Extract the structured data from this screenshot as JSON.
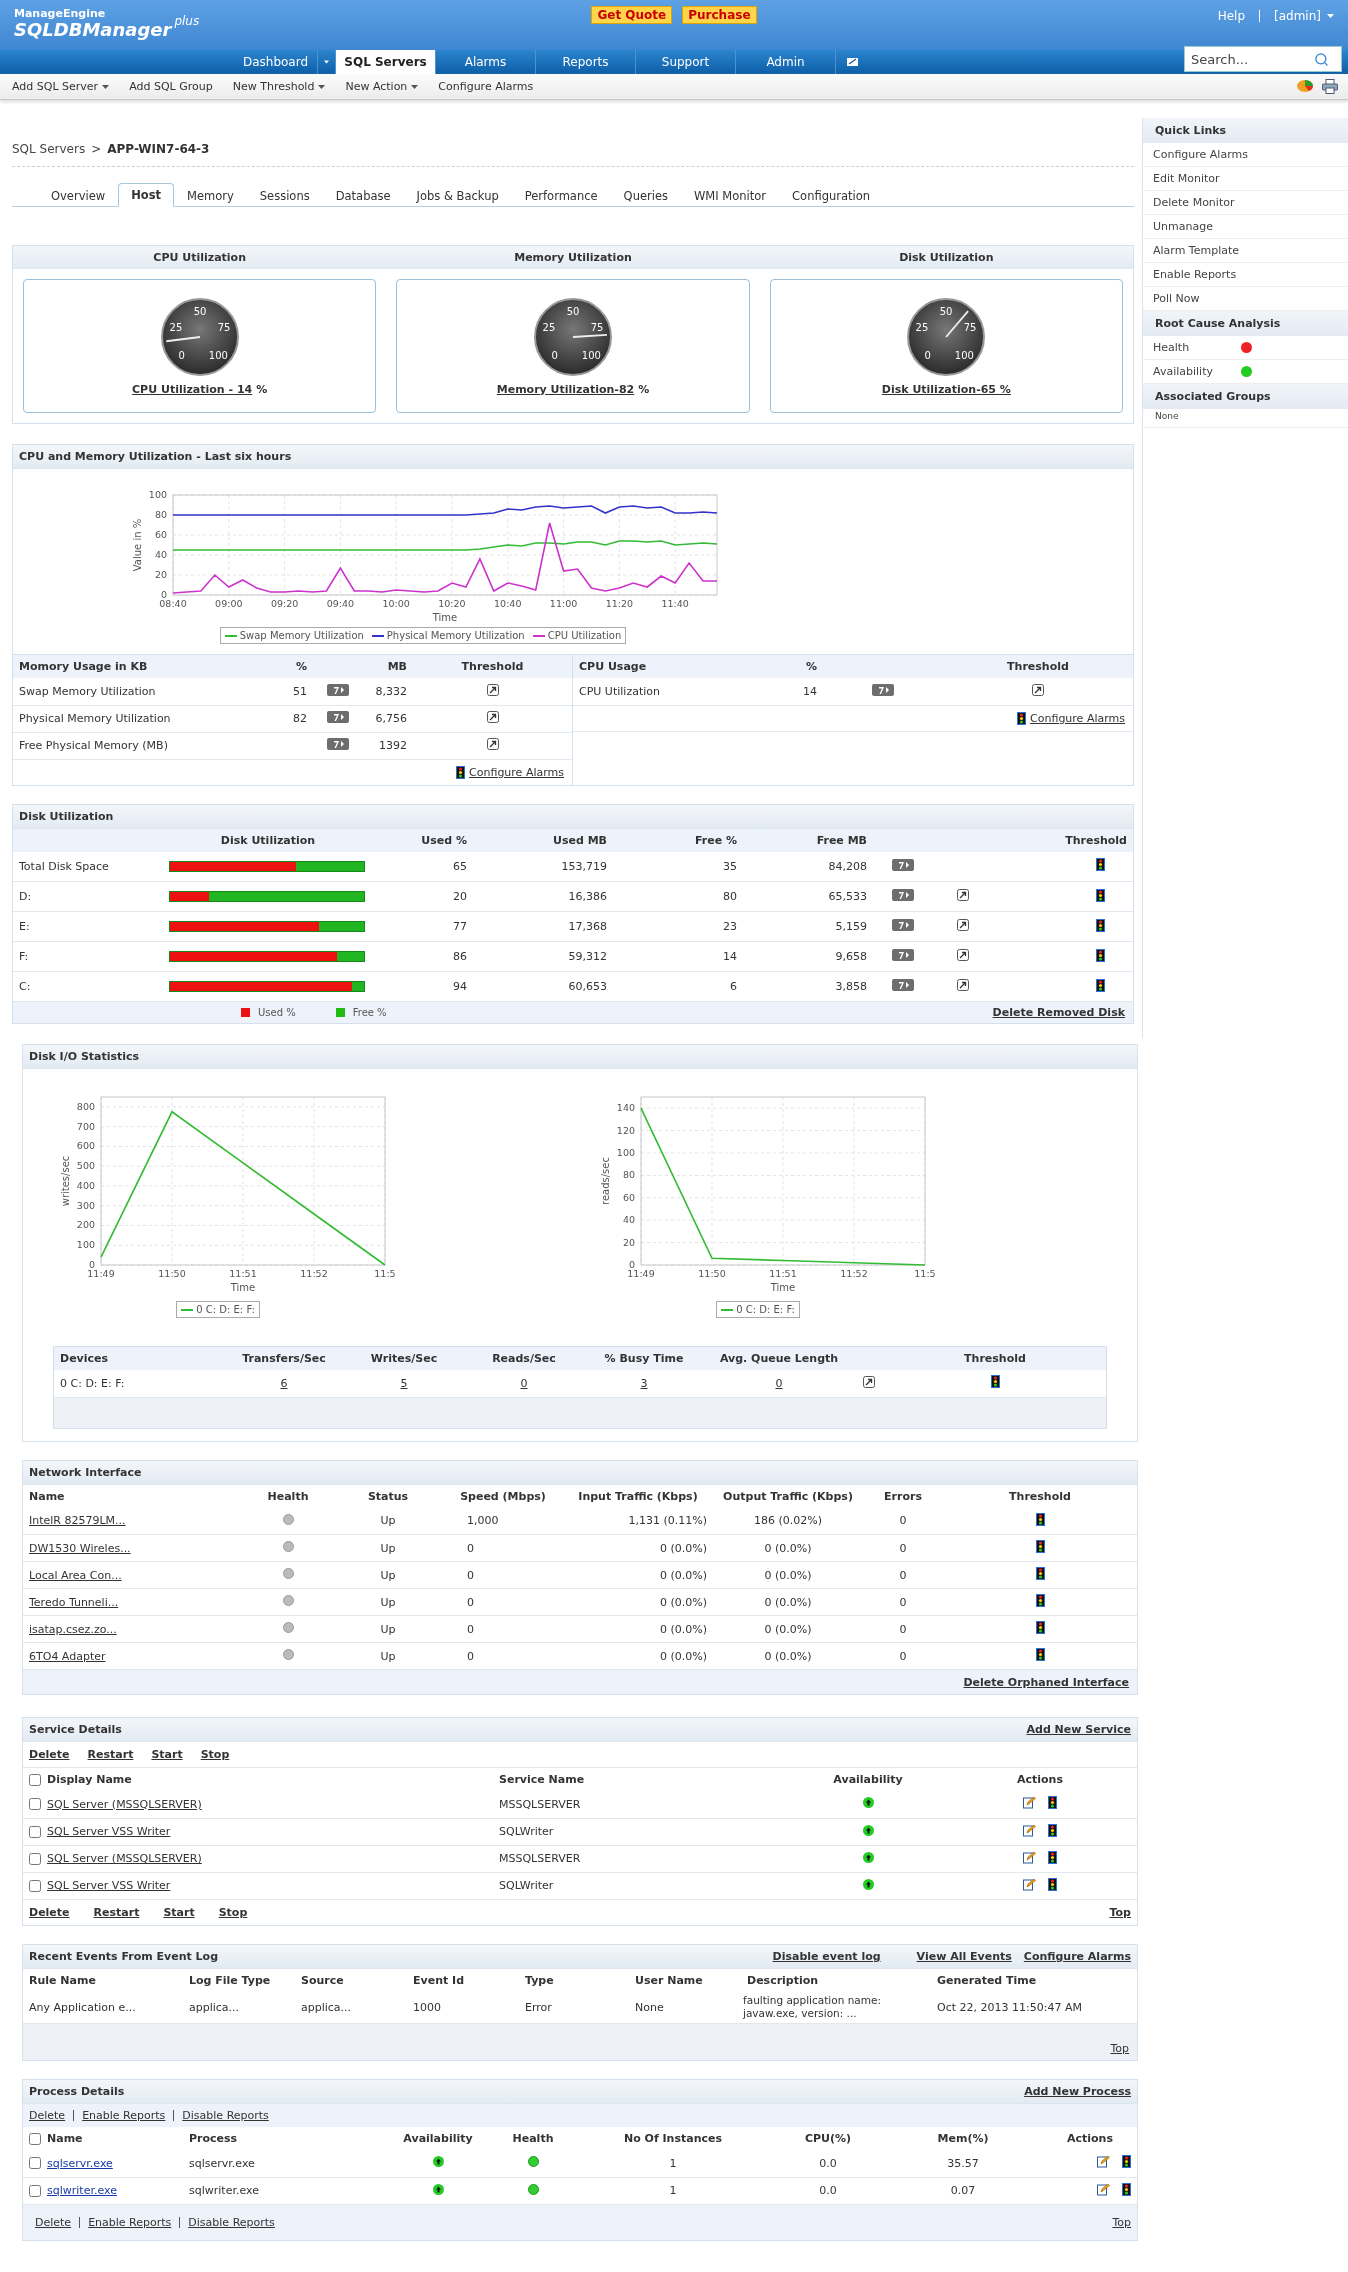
{
  "header": {
    "logo_top": "ManageEngine",
    "logo_main": "SQLDBManager",
    "logo_sup": "plus",
    "buttons": [
      "Get Quote",
      "Purchase"
    ],
    "help": "Help",
    "user": "[admin]"
  },
  "nav": {
    "items": [
      {
        "label": "Dashboard",
        "selected": false,
        "split": true
      },
      {
        "label": "SQL Servers",
        "selected": true,
        "split": false
      },
      {
        "label": "Alarms",
        "selected": false,
        "split": false
      },
      {
        "label": "Reports",
        "selected": false,
        "split": false
      },
      {
        "label": "Support",
        "selected": false,
        "split": false
      },
      {
        "label": "Admin",
        "selected": false,
        "split": false
      }
    ],
    "search": {
      "placeholder": "Search..."
    }
  },
  "toolbar": {
    "items": [
      {
        "label": "Add SQL Server",
        "dropdown": true
      },
      {
        "label": "Add SQL Group",
        "dropdown": false
      },
      {
        "label": "New Threshold",
        "dropdown": true
      },
      {
        "label": "New Action",
        "dropdown": true
      },
      {
        "label": "Configure Alarms",
        "dropdown": false
      }
    ]
  },
  "breadcrumb": {
    "parent": "SQL Servers",
    "separator": ">",
    "current": "APP-WIN7-64-3"
  },
  "tabs": [
    {
      "label": "Overview",
      "selected": false
    },
    {
      "label": "Host",
      "selected": true
    },
    {
      "label": "Memory",
      "selected": false
    },
    {
      "label": "Sessions",
      "selected": false
    },
    {
      "label": "Database",
      "selected": false
    },
    {
      "label": "Jobs & Backup",
      "selected": false
    },
    {
      "label": "Performance",
      "selected": false
    },
    {
      "label": "Queries",
      "selected": false
    },
    {
      "label": "WMI Monitor",
      "selected": false
    },
    {
      "label": "Configuration",
      "selected": false
    }
  ],
  "gauges": [
    {
      "title": "CPU Utilization",
      "level": 0.14,
      "scale": [
        "0",
        "25",
        "50",
        "75",
        "100"
      ],
      "link": "CPU Utilization - 14",
      "unit": "%"
    },
    {
      "title": "Memory Utilization",
      "level": 0.82,
      "scale": [
        "0",
        "25",
        "50",
        "75",
        "100"
      ],
      "link": "Memory Utilization-82",
      "unit": "%"
    },
    {
      "title": "Disk Utilization",
      "level": 0.65,
      "scale": [
        "0",
        "25",
        "50",
        "75",
        "100"
      ],
      "link": "Disk Utilization-65 %"
    }
  ],
  "cpu_memory": {
    "title": "CPU and Memory Utilization - Last six hours",
    "chart_data": {
      "type": "line",
      "xlabel": "Time",
      "ylabel": "Value in %",
      "ylim": [
        0,
        100
      ],
      "yticks": [
        0,
        20,
        40,
        60,
        80,
        100
      ],
      "grid": true,
      "legend": "bottom",
      "categories": [
        "08:40",
        null,
        null,
        null,
        "09:00",
        null,
        null,
        null,
        "09:20",
        null,
        null,
        null,
        "09:40",
        null,
        null,
        null,
        "10:00",
        null,
        null,
        null,
        "10:20",
        null,
        null,
        null,
        "10:40",
        null,
        null,
        null,
        "11:00",
        null,
        null,
        null,
        "11:20",
        null,
        null,
        null,
        "11:40",
        null,
        null,
        null
      ],
      "series": [
        {
          "name": "Swap Memory Utilization",
          "color": "#33bb33",
          "values": [
            45,
            45,
            45,
            45,
            45,
            45,
            45,
            45,
            45,
            45,
            45,
            45,
            45,
            45,
            45,
            45,
            45,
            45,
            45,
            45,
            45,
            45,
            46,
            48,
            50,
            49,
            52,
            52,
            51,
            53,
            53,
            50,
            54,
            54,
            53,
            54,
            50,
            51,
            52,
            51
          ]
        },
        {
          "name": "Physical Memory Utilization",
          "color": "#3333cc",
          "values": [
            80,
            80,
            80,
            80,
            80,
            80,
            80,
            80,
            80,
            80,
            80,
            80,
            80,
            80,
            80,
            80,
            80,
            80,
            80,
            80,
            80,
            80,
            81,
            82,
            86,
            85,
            88,
            89,
            87,
            88,
            89,
            82,
            88,
            89,
            87,
            88,
            82,
            82,
            83,
            82
          ]
        },
        {
          "name": "CPU Utilization",
          "color": "#cc33cc",
          "values": [
            2,
            3,
            4,
            20,
            8,
            15,
            7,
            3,
            3,
            4,
            3,
            4,
            27,
            4,
            4,
            3,
            5,
            4,
            3,
            4,
            12,
            8,
            36,
            4,
            12,
            9,
            5,
            72,
            24,
            26,
            7,
            4,
            7,
            12,
            8,
            19,
            12,
            32,
            14,
            14
          ]
        }
      ]
    },
    "memory_table": {
      "columns": [
        "Momory Usage in KB",
        "%",
        "MB",
        "Threshold"
      ],
      "rows": [
        {
          "name": "Swap Memory Utilization",
          "percent": "51",
          "mb": "8,332"
        },
        {
          "name": "Physical Memory Utilization",
          "percent": "82",
          "mb": "6,756"
        },
        {
          "name": "Free Physical Memory (MB)",
          "mb": "1392"
        }
      ],
      "configure": "Configure Alarms"
    },
    "cpu_table": {
      "columns": [
        "CPU Usage",
        "%",
        "Threshold"
      ],
      "rows": [
        {
          "name": "CPU Utilization",
          "percent": "14"
        }
      ],
      "configure": "Configure Alarms"
    }
  },
  "disk": {
    "title": "Disk Utilization",
    "columns": [
      "Disk Utilization",
      "Used %",
      "Used MB",
      "Free %",
      "Free MB",
      "Threshold"
    ],
    "rows": [
      {
        "name": "Total Disk Space",
        "level": 0.65,
        "used_pct": "65",
        "used_mb": "153,719",
        "free_pct": "35",
        "free_mb": "84,208",
        "edit": false
      },
      {
        "name": "D:",
        "level": 0.2,
        "used_pct": "20",
        "used_mb": "16,386",
        "free_pct": "80",
        "free_mb": "65,533",
        "edit": true
      },
      {
        "name": "E:",
        "level": 0.77,
        "used_pct": "77",
        "used_mb": "17,368",
        "free_pct": "23",
        "free_mb": "5,159",
        "edit": true
      },
      {
        "name": "F:",
        "level": 0.86,
        "used_pct": "86",
        "used_mb": "59,312",
        "free_pct": "14",
        "free_mb": "9,658",
        "edit": true
      },
      {
        "name": "C:",
        "level": 0.94,
        "used_pct": "94",
        "used_mb": "60,653",
        "free_pct": "6",
        "free_mb": "3,858",
        "edit": true
      }
    ],
    "legend": [
      {
        "label": "Used %",
        "color": "#ee1111"
      },
      {
        "label": "Free %",
        "color": "#22bb11"
      }
    ],
    "link": "Delete Removed Disk"
  },
  "disk_io": {
    "title": "Disk I/O Statistics",
    "charts": [
      {
        "chart_data": {
          "type": "line",
          "xlabel": "Time",
          "ylabel": "writes/sec",
          "ylim": [
            0,
            850
          ],
          "yticks": [
            0,
            100,
            200,
            300,
            400,
            500,
            600,
            700,
            800
          ],
          "grid": true,
          "legend": "bottom",
          "categories": [
            "11:49",
            "11:50",
            "11:51",
            "11:52",
            "11:5"
          ],
          "series": [
            {
              "name": "0 C: D: E: F:",
              "color": "#33bb33",
              "values": [
                40,
                775,
                517,
                258,
                0
              ]
            }
          ]
        }
      },
      {
        "chart_data": {
          "type": "line",
          "xlabel": "Time",
          "ylabel": "reads/sec",
          "ylim": [
            0,
            150
          ],
          "yticks": [
            0,
            20,
            40,
            60,
            80,
            100,
            120,
            140
          ],
          "grid": true,
          "legend": "bottom",
          "categories": [
            "11:49",
            "11:50",
            "11:51",
            "11:52",
            "11:5"
          ],
          "series": [
            {
              "name": "0 C: D: E: F:",
              "color": "#33bb33",
              "values": [
                140,
                6,
                4,
                2,
                0
              ]
            }
          ]
        }
      }
    ],
    "columns": [
      "Devices",
      "Transfers/Sec",
      "Writes/Sec",
      "Reads/Sec",
      "% Busy Time",
      "Avg. Queue Length",
      "Threshold"
    ],
    "rows": [
      {
        "device": "0 C: D: E: F:",
        "values": [
          "6",
          "5",
          "0",
          "3",
          "0"
        ]
      }
    ]
  },
  "network": {
    "title": "Network Interface",
    "columns": [
      "Name",
      "Health",
      "Status",
      "Speed (Mbps)",
      "Input Traffic (Kbps)",
      "Output Traffic (Kbps)",
      "Errors",
      "Threshold"
    ],
    "rows": [
      {
        "name": "IntelR 82579LM...",
        "status": "Up",
        "speed": "1,000",
        "input": "1,131 (0.11%)",
        "output": "186 (0.02%)",
        "errors": "0"
      },
      {
        "name": "DW1530 Wireles...",
        "status": "Up",
        "speed": "0",
        "input": "0 (0.0%)",
        "output": "0 (0.0%)",
        "errors": "0"
      },
      {
        "name": "Local Area Con...",
        "status": "Up",
        "speed": "0",
        "input": "0 (0.0%)",
        "output": "0 (0.0%)",
        "errors": "0"
      },
      {
        "name": "Teredo Tunneli...",
        "status": "Up",
        "speed": "0",
        "input": "0 (0.0%)",
        "output": "0 (0.0%)",
        "errors": "0"
      },
      {
        "name": "isatap.csez.zo...",
        "status": "Up",
        "speed": "0",
        "input": "0 (0.0%)",
        "output": "0 (0.0%)",
        "errors": "0"
      },
      {
        "name": "6TO4 Adapter",
        "status": "Up",
        "speed": "0",
        "input": "0 (0.0%)",
        "output": "0 (0.0%)",
        "errors": "0"
      }
    ],
    "link": "Delete Orphaned Interface"
  },
  "services": {
    "title": "Service Details",
    "add_link": "Add New Service",
    "actions_top": [
      "Delete",
      "Restart",
      "Start",
      "Stop"
    ],
    "select_all": {
      "checked": false
    },
    "columns": [
      "Display Name",
      "Service Name",
      "Availability",
      "Actions"
    ],
    "rows": [
      {
        "name": "SQL Server (MSSQLSERVER)",
        "service": "MSSQLSERVER",
        "checked": false
      },
      {
        "name": "SQL Server VSS Writer",
        "service": "SQLWriter",
        "checked": false
      },
      {
        "name": "SQL Server (MSSQLSERVER)",
        "service": "MSSQLSERVER",
        "checked": false
      },
      {
        "name": "SQL Server VSS Writer",
        "service": "SQLWriter",
        "checked": false
      }
    ],
    "actions_bottom": [
      "Delete",
      "Restart",
      "Start",
      "Stop"
    ],
    "top_link": "Top"
  },
  "events": {
    "title": "Recent Events From Event Log",
    "links": [
      "Disable event log",
      "View All Events",
      "Configure Alarms"
    ],
    "columns": [
      "Rule Name",
      "Log File Type",
      "Source",
      "Event Id",
      "Type",
      "User Name",
      "Description",
      "Generated Time"
    ],
    "rows": [
      [
        "Any Application e...",
        "applica...",
        "applica...",
        "1000",
        "Error",
        "None",
        "faulting application name: javaw.exe, version: ...",
        "Oct 22, 2013 11:50:47 AM"
      ]
    ],
    "top_link": "Top"
  },
  "processes": {
    "title": "Process Details",
    "add_link": "Add New Process",
    "actions_top": [
      "Delete",
      "Enable Reports",
      "Disable Reports"
    ],
    "select_all": {
      "checked": false
    },
    "columns": [
      "Name",
      "Process",
      "Availability",
      "Health",
      "No Of Instances",
      "CPU(%)",
      "Mem(%)",
      "Actions"
    ],
    "rows": [
      {
        "name": "sqlservr.exe",
        "process": "sqlservr.exe",
        "instances": "1",
        "cpu": "0.0",
        "mem": "35.57",
        "checked": false
      },
      {
        "name": "sqlwriter.exe",
        "process": "sqlwriter.exe",
        "instances": "1",
        "cpu": "0.0",
        "mem": "0.07",
        "checked": false
      }
    ],
    "actions_bottom": [
      "Delete",
      "Enable Reports",
      "Disable Reports"
    ],
    "top_link": "Top"
  },
  "sidebar": {
    "sections": [
      {
        "title": "Quick Links",
        "items": [
          {
            "label": "Configure Alarms",
            "kind": "link"
          },
          {
            "label": "Edit Monitor",
            "kind": "link"
          },
          {
            "label": "Delete Monitor",
            "kind": "link"
          },
          {
            "label": "Unmanage",
            "kind": "link"
          },
          {
            "label": "Alarm Template",
            "kind": "link"
          },
          {
            "label": "Enable Reports",
            "kind": "link"
          },
          {
            "label": "Poll Now",
            "kind": "link"
          }
        ]
      },
      {
        "title": "Root Cause Analysis",
        "items": [
          {
            "label": "Health",
            "kind": "status",
            "color": "#ee2222"
          },
          {
            "label": "Availability",
            "kind": "status",
            "color": "#22cc22"
          }
        ]
      },
      {
        "title": "Associated Groups",
        "items": [
          {
            "label": "None",
            "kind": "note"
          }
        ]
      }
    ]
  }
}
